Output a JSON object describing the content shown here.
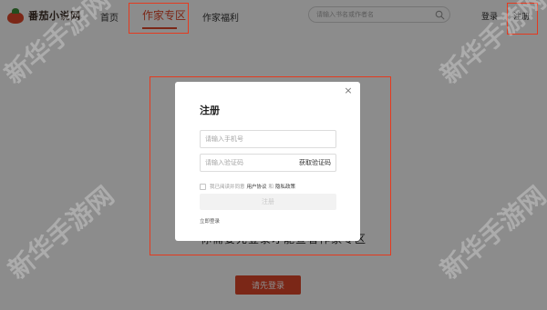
{
  "header": {
    "logo_text": "番茄小说网",
    "nav": {
      "home": "首页",
      "author_zone": "作家专区",
      "author_welfare": "作家福利"
    },
    "search": {
      "placeholder": "请输入书名或作者名"
    },
    "login": "登录",
    "register": "注册"
  },
  "page": {
    "background_text": "你需要先登录才能查看作家专区",
    "please_login_button": "请先登录"
  },
  "modal": {
    "close": "×",
    "title": "注册",
    "phone_placeholder": "请输入手机号",
    "code_placeholder": "请输入验证码",
    "get_code": "获取验证码",
    "agree_prefix": "我已阅读并同意",
    "user_agreement": "用户协议",
    "and": "和",
    "privacy_policy": "隐私政策",
    "register_button": "注册",
    "login_now": "立即登录"
  },
  "watermark": "新华手游网",
  "colors": {
    "brand": "#e0482b",
    "annotation": "#e53a1f"
  },
  "icons": [
    "tomato-logo-icon",
    "search-icon",
    "close-icon",
    "checkbox-icon"
  ]
}
